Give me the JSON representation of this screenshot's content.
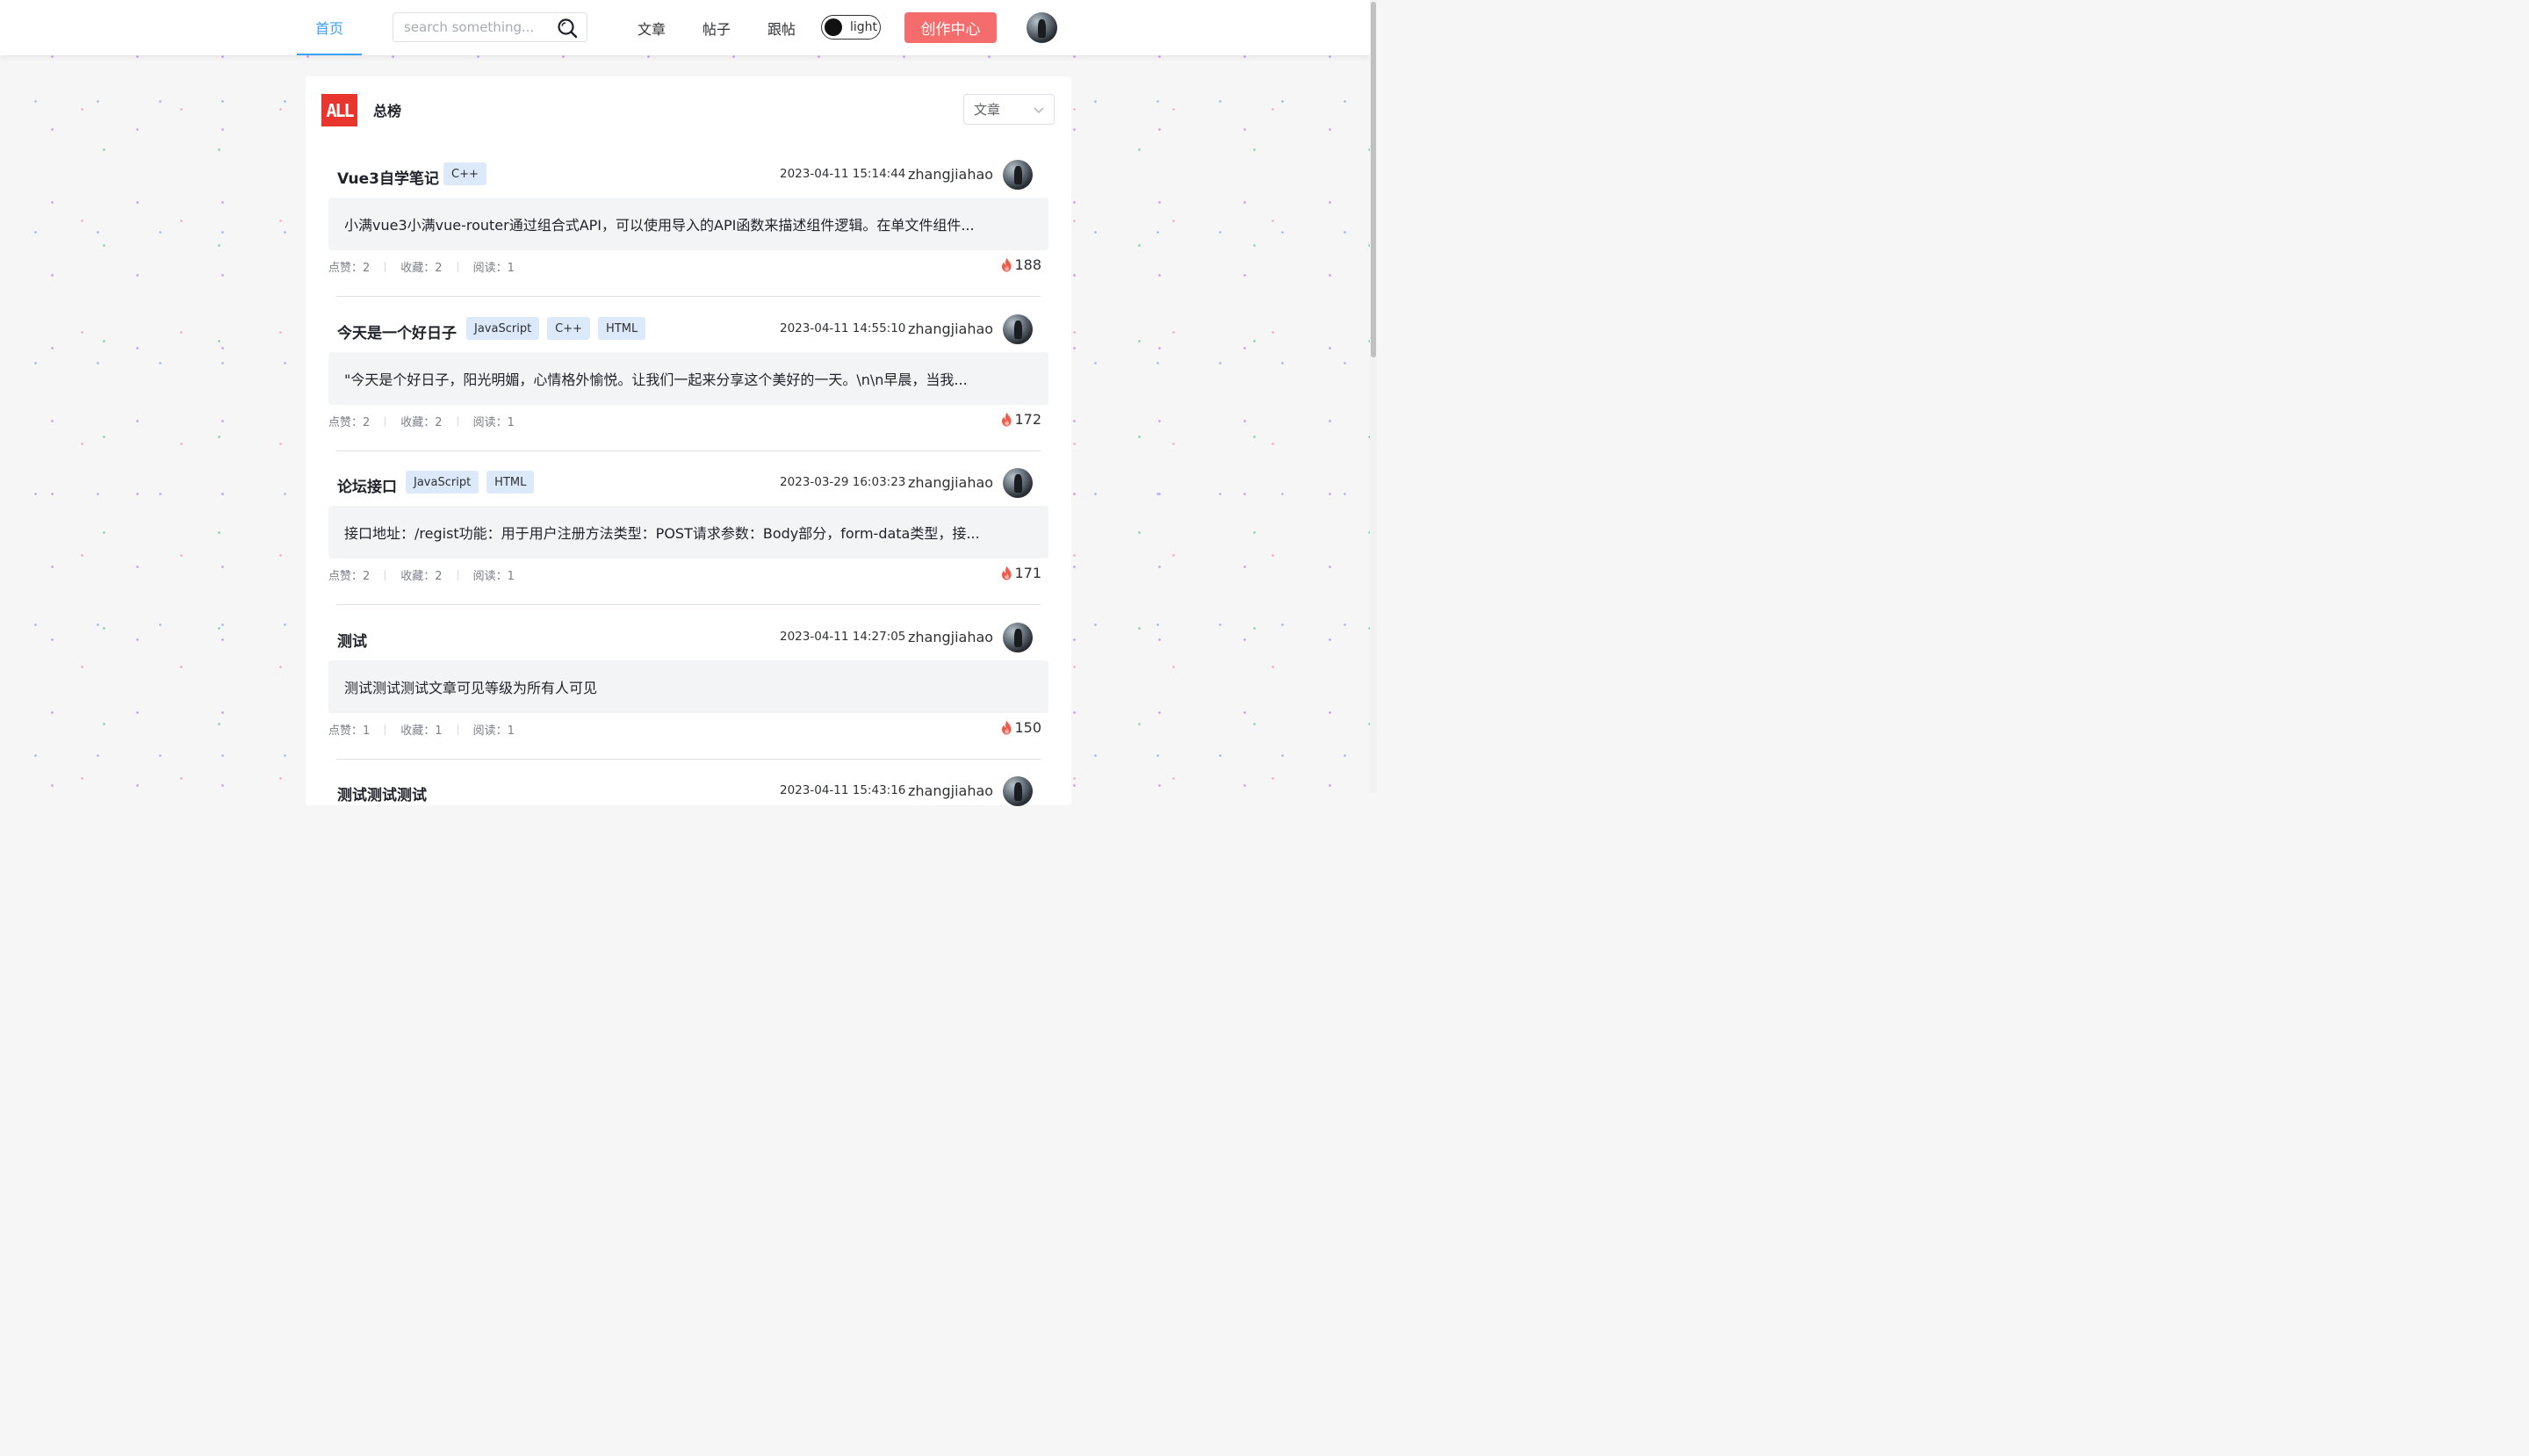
{
  "header": {
    "home_label": "首页",
    "search_placeholder": "search something...",
    "nav": [
      "文章",
      "帖子",
      "跟帖"
    ],
    "theme_toggle_label": "light",
    "create_label": "创作中心"
  },
  "colors": {
    "accent": "#409eff",
    "create_button": "#f56c6c",
    "logo_red": "#e8362e",
    "tag_bg": "#dbe9fb",
    "fire": "#f05a4a"
  },
  "ranking": {
    "logo_text": "ALL",
    "title": "总榜",
    "filter_value": "文章",
    "articles": [
      {
        "title": "Vue3自学笔记",
        "tags": [
          "C++"
        ],
        "date": "2023-04-11 15:14:44",
        "author": "zhangjiahao",
        "summary": "小满vue3小满vue-router通过组合式API，可以使用导入的API函数来描述组件逻辑。在单文件组件...",
        "likes_label": "点赞：2",
        "favorites_label": "收藏：2",
        "reads_label": "阅读：1",
        "hot": "188"
      },
      {
        "title": "今天是一个好日子",
        "tags": [
          "JavaScript",
          "C++",
          "HTML"
        ],
        "date": "2023-04-11 14:55:10",
        "author": "zhangjiahao",
        "summary": "\"今天是个好日子，阳光明媚，心情格外愉悦。让我们一起来分享这个美好的一天。\\n\\n早晨，当我...",
        "likes_label": "点赞：2",
        "favorites_label": "收藏：2",
        "reads_label": "阅读：1",
        "hot": "172"
      },
      {
        "title": "论坛接口",
        "tags": [
          "JavaScript",
          "HTML"
        ],
        "date": "2023-03-29 16:03:23",
        "author": "zhangjiahao",
        "summary": "接口地址：/regist功能：用于用户注册方法类型：POST请求参数：Body部分，form-data类型，接...",
        "likes_label": "点赞：2",
        "favorites_label": "收藏：2",
        "reads_label": "阅读：1",
        "hot": "171"
      },
      {
        "title": "测试",
        "tags": [],
        "date": "2023-04-11 14:27:05",
        "author": "zhangjiahao",
        "summary": "测试测试测试文章可见等级为所有人可见",
        "likes_label": "点赞：1",
        "favorites_label": "收藏：1",
        "reads_label": "阅读：1",
        "hot": "150"
      },
      {
        "title": "测试测试测试",
        "tags": [],
        "date": "2023-04-11 15:43:16",
        "author": "zhangjiahao",
        "summary": "",
        "likes_label": "",
        "favorites_label": "",
        "reads_label": "",
        "hot": ""
      }
    ]
  }
}
